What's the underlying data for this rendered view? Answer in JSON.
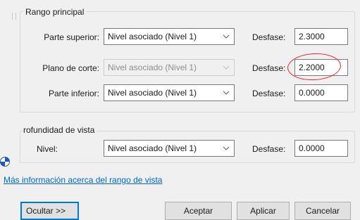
{
  "main_range": {
    "title": "Rango principal",
    "top": {
      "label": "Parte superior:",
      "level": "Nivel asociado (Nivel 1)",
      "offset_label": "Desfase:",
      "offset": "2.3000"
    },
    "cut_plane": {
      "label": "Plano de corte:",
      "level": "Nivel asociado (Nivel 1)",
      "offset_label": "Desfase:",
      "offset": "2.2000"
    },
    "bottom": {
      "label": "Parte inferior:",
      "level": "Nivel asociado (Nivel 1)",
      "offset_label": "Desfase:",
      "offset": "0.0000"
    }
  },
  "view_depth": {
    "title": "rofundidad de vista",
    "level": {
      "label": "Nivel:",
      "level": "Nivel asociado (Nivel 1)",
      "offset_label": "Desfase:",
      "offset": "0.0000"
    }
  },
  "more_info_link": "Más información acerca del rango de vista",
  "buttons": {
    "hide": "Ocultar >>",
    "ok": "Aceptar",
    "apply": "Aplicar",
    "cancel": "Cancelar"
  },
  "colors": {
    "highlight": "#e8242b",
    "link": "#0066cc",
    "focus": "#0078d7"
  },
  "icons": {
    "dropdown": "chevron-down-icon",
    "info": "pie-info-icon"
  }
}
